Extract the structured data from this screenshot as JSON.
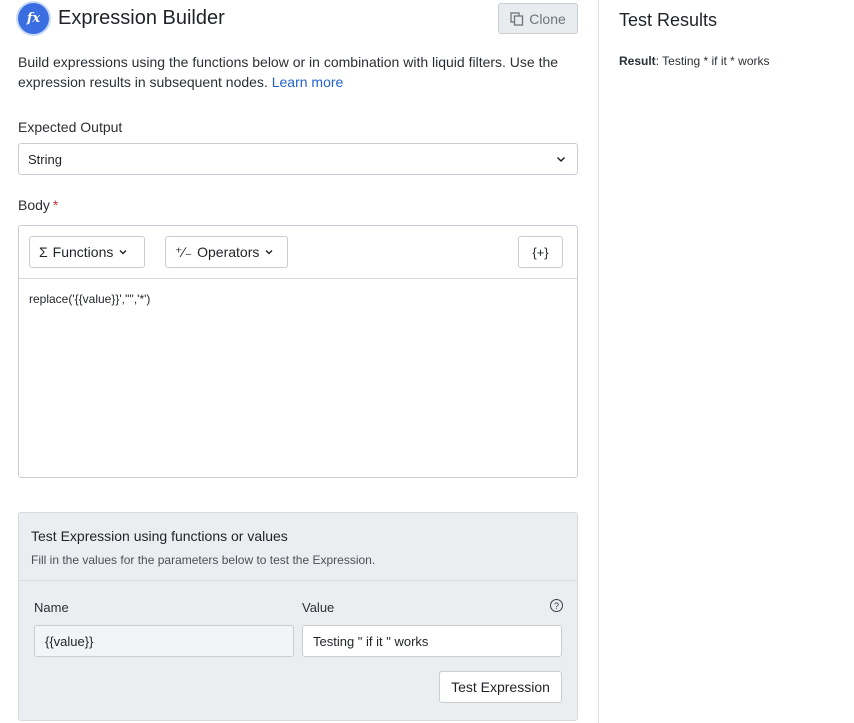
{
  "header": {
    "logo_text": "fx",
    "title": "Expression Builder",
    "clone_label": "Clone"
  },
  "description": {
    "text": "Build expressions using the functions below or in combination with liquid filters. Use the expression results in subsequent nodes.",
    "link": "Learn more"
  },
  "expected_output": {
    "label": "Expected Output",
    "value": "String"
  },
  "body": {
    "label": "Body",
    "required_mark": "*",
    "toolbar": {
      "functions_icon": "Σ",
      "functions_label": "Functions",
      "operators_icon": "⁺∕₋",
      "operators_label": "Operators",
      "insert_label": "{+}"
    },
    "code": "replace('{{value}}','\"','*')"
  },
  "test_panel": {
    "title": "Test Expression using functions or values",
    "subtitle": "Fill in the values for the parameters below to test the Expression.",
    "name_header": "Name",
    "value_header": "Value",
    "help_icon": "?",
    "param_name": "{{value}}",
    "param_value": "Testing \" if it \" works",
    "test_button": "Test Expression"
  },
  "results": {
    "title": "Test Results",
    "result_label": "Result",
    "result_value": "Testing * if it * works"
  },
  "colors": {
    "accent": "#3a6ee0",
    "link": "#2463c9",
    "required": "#d1343b",
    "panel_bg": "#ebeef1"
  }
}
